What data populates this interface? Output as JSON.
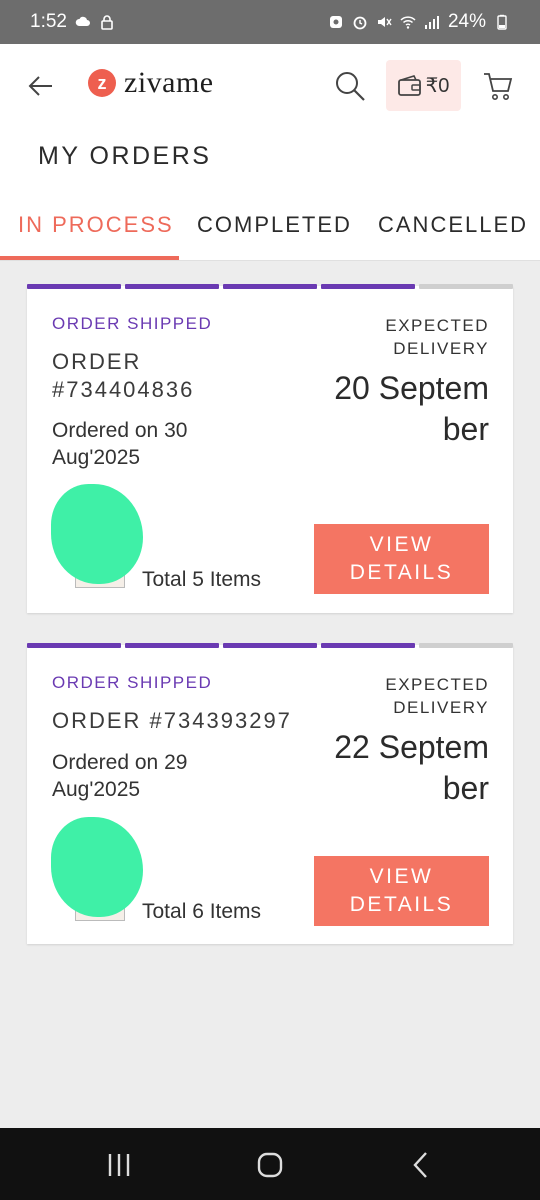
{
  "statusbar": {
    "time": "1:52",
    "battery": "24%"
  },
  "header": {
    "brand": "zivame",
    "brand_mark": "z",
    "wallet_amount": "₹0"
  },
  "page": {
    "title": "MY ORDERS"
  },
  "tabs": [
    {
      "label": "IN PROCESS",
      "active": true
    },
    {
      "label": "COMPLETED",
      "active": false
    },
    {
      "label": "CANCELLED",
      "active": false
    }
  ],
  "orders": [
    {
      "status": "ORDER SHIPPED",
      "order_number": "ORDER #734404836",
      "ordered_on": "Ordered on 30 Aug'2025",
      "expected_label": "EXPECTED DELIVERY",
      "expected_date": "20 September",
      "total_items": "Total 5 Items",
      "button": "VIEW DETAILS",
      "progress_steps_done": 4,
      "progress_steps_total": 5
    },
    {
      "status": "ORDER SHIPPED",
      "order_number": "ORDER #734393297",
      "ordered_on": "Ordered on 29 Aug'2025",
      "expected_label": "EXPECTED DELIVERY",
      "expected_date": "22 September",
      "total_items": "Total 6 Items",
      "button": "VIEW DETAILS",
      "progress_steps_done": 4,
      "progress_steps_total": 5
    }
  ],
  "colors": {
    "accent": "#ee6a5a",
    "button": "#f47563",
    "status": "#6a3ab2",
    "progress_off": "#cfcfcf"
  },
  "icons": {
    "back": "back-arrow-icon",
    "search": "search-icon",
    "wallet": "wallet-icon",
    "cart": "cart-icon",
    "nav_recents": "recents-icon",
    "nav_home": "home-icon",
    "nav_back": "nav-back-icon"
  }
}
